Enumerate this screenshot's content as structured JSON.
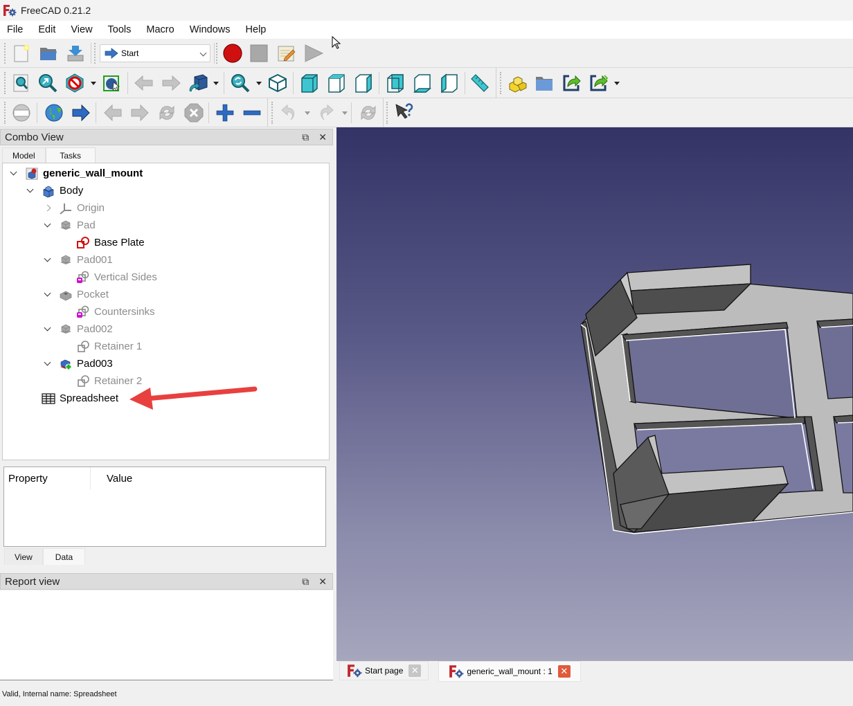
{
  "window": {
    "title": "FreeCAD 0.21.2",
    "app_icon": "freecad-logo-icon"
  },
  "menubar": {
    "items": [
      "File",
      "Edit",
      "View",
      "Tools",
      "Macro",
      "Windows",
      "Help"
    ]
  },
  "toolbars": {
    "file": [
      "new-document-icon",
      "open-folder-icon",
      "save-icon"
    ],
    "workbench_selector": {
      "selected": "Start",
      "icon": "arrow-right-icon"
    },
    "macro": [
      "record-macro-icon",
      "stop-macro-icon",
      "edit-macro-icon",
      "run-macro-icon"
    ],
    "view": [
      "fit-all-icon",
      "fit-selection-icon",
      "draw-style-icon",
      "bounding-box-icon",
      "back-icon",
      "forward-icon",
      "std-views-icon",
      "zoom-icon",
      "isometric-icon",
      "front-view-icon",
      "top-view-icon",
      "right-view-icon",
      "rear-view-icon",
      "bottom-view-icon",
      "left-view-icon",
      "measure-icon"
    ],
    "structure": [
      "part-icon",
      "group-icon",
      "link-icon",
      "link-actions-icon"
    ],
    "web": [
      "web-home-icon",
      "globe-icon",
      "go-icon",
      "web-back-icon",
      "web-forward-icon",
      "refresh-icon",
      "stop-icon",
      "zoom-in-icon",
      "zoom-out-icon"
    ],
    "edit": [
      "undo-icon",
      "redo-icon",
      "recompute-icon",
      "whats-this-icon"
    ]
  },
  "combo_view": {
    "title": "Combo View",
    "tabs": [
      "Model",
      "Tasks"
    ],
    "active_tab": "Model",
    "tree": [
      {
        "label": "generic_wall_mount",
        "level": 0,
        "expander": "down",
        "icon": "document-icon",
        "style": "bold"
      },
      {
        "label": "Body",
        "level": 1,
        "expander": "down",
        "icon": "body-icon",
        "style": "normal"
      },
      {
        "label": "Origin",
        "level": 2,
        "expander": "right",
        "icon": "origin-axes-icon",
        "style": "dim"
      },
      {
        "label": "Pad",
        "level": 2,
        "expander": "down",
        "icon": "pad-icon",
        "style": "dim"
      },
      {
        "label": "Base Plate",
        "level": 3,
        "expander": "none",
        "icon": "sketch-error-icon",
        "style": "normal"
      },
      {
        "label": "Pad001",
        "level": 2,
        "expander": "down",
        "icon": "pad-icon",
        "style": "dim"
      },
      {
        "label": "Vertical Sides",
        "level": 3,
        "expander": "none",
        "icon": "sketch-attached-icon",
        "style": "dim"
      },
      {
        "label": "Pocket",
        "level": 2,
        "expander": "down",
        "icon": "pocket-icon",
        "style": "dim"
      },
      {
        "label": "Countersinks",
        "level": 3,
        "expander": "none",
        "icon": "sketch-attached-icon",
        "style": "dim"
      },
      {
        "label": "Pad002",
        "level": 2,
        "expander": "down",
        "icon": "pad-icon",
        "style": "dim"
      },
      {
        "label": "Retainer 1",
        "level": 3,
        "expander": "none",
        "icon": "sketch-icon",
        "style": "dim"
      },
      {
        "label": "Pad003",
        "level": 2,
        "expander": "down",
        "icon": "pad-tip-icon",
        "style": "normal"
      },
      {
        "label": "Retainer 2",
        "level": 3,
        "expander": "none",
        "icon": "sketch-icon",
        "style": "dim"
      },
      {
        "label": "Spreadsheet",
        "level": 1,
        "expander": "none",
        "icon": "spreadsheet-icon",
        "style": "normal"
      }
    ],
    "property_header": {
      "property": "Property",
      "value": "Value"
    },
    "property_tabs": [
      "View",
      "Data"
    ],
    "active_property_tab": "Data"
  },
  "report_view": {
    "title": "Report view",
    "content": ""
  },
  "document_tabs": [
    {
      "label": "Start page",
      "active": false
    },
    {
      "label": "generic_wall_mount : 1",
      "active": true
    }
  ],
  "statusbar": {
    "text": "Valid, Internal name: Spreadsheet"
  },
  "annotation": {
    "arrow_color": "#e8403f",
    "points_to": "Spreadsheet"
  },
  "colors": {
    "viewport_top": "#333366",
    "viewport_bottom": "#a6a6bd",
    "model_face": "#bcbcbc",
    "model_side": "#555555"
  }
}
